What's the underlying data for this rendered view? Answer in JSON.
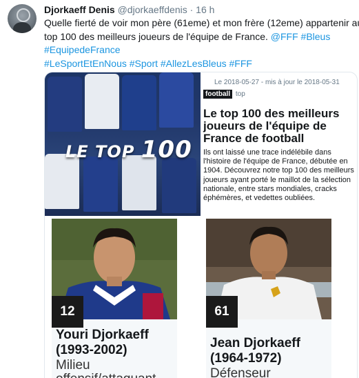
{
  "tweet": {
    "author_name": "Djorkaeff Denis",
    "author_handle": "@djorkaeffdenis",
    "separator": "·",
    "time": "16 h",
    "text_line1": "Quelle fierté de voir mon père (61eme) et mon frère (12eme) appartenir au",
    "text_line2_plain": "top 100 des meilleurs joueurs de l'équipe de France.",
    "mention_fff": "@FFF",
    "hashtag_bleus": "#Bleus",
    "hashtag_equipedefrance": "#EquipedeFrance",
    "hashtags_line4": [
      "#LeSportEtEnNous",
      "#Sport",
      "#AllezLesBleus",
      "#FFF"
    ]
  },
  "card": {
    "hero_title_le": "LE TOP",
    "hero_title_num": "100",
    "meta": "Le 2018-05-27 - mis à jour le 2018-05-31",
    "section_tag": "football",
    "section_top": "top",
    "title": "Le top 100 des meilleurs joueurs de l'équipe de France de football",
    "description": "Ils ont laissé une trace indélébile dans l'histoire de l'équipe de France, débutée en 1904. Découvrez notre top 100 des meilleurs joueurs ayant porté le maillot de la sélection nationale, entre stars mondiales, cracks éphémères, et vedettes oubliées.",
    "players": [
      {
        "rank": "12",
        "name": "Youri Djorkaeff",
        "years": "(1993-2002)",
        "position_line1": "Milieu",
        "position_line2": "offensif/attaquant"
      },
      {
        "rank": "61",
        "name": "Jean Djorkaeff",
        "years": "(1964-1972)",
        "position_line1": "Défenseur"
      }
    ]
  },
  "colors": {
    "link": "#1b95e0",
    "muted": "#657786",
    "text": "#14171a",
    "border": "#e1e8ed",
    "rank_bg": "#1a1a1a"
  }
}
